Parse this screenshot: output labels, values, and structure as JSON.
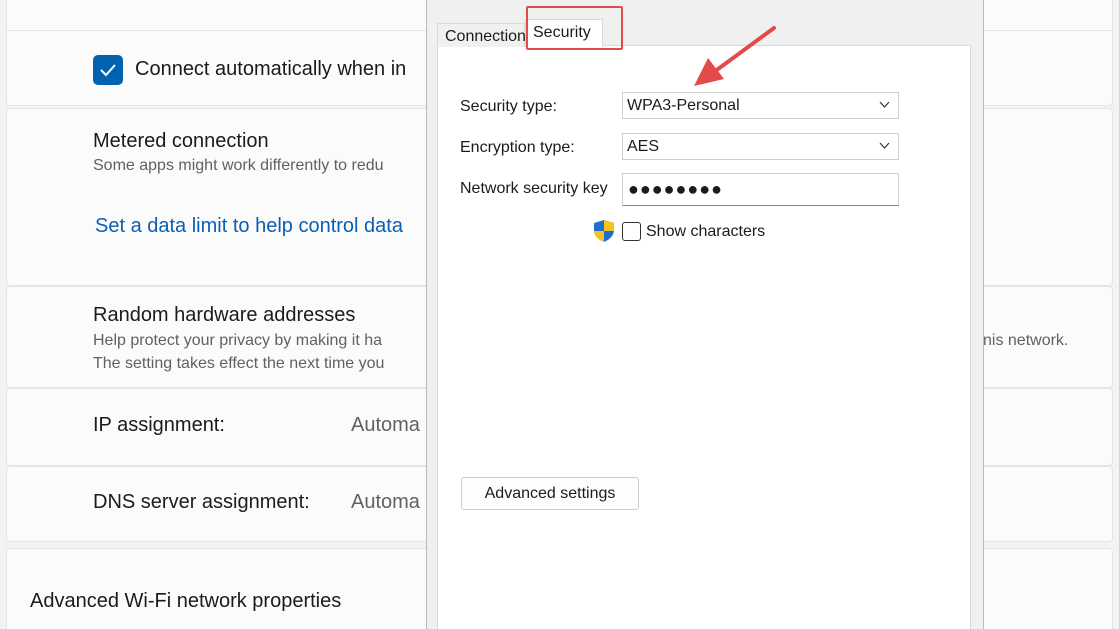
{
  "background": {
    "connect_auto_label": "Connect automatically when in",
    "metered_title": "Metered connection",
    "metered_desc": "Some apps might work differently to redu",
    "data_limit_link": "Set a data limit to help control data",
    "random_hw_title": "Random hardware addresses",
    "random_hw_desc1": "Help protect your privacy by making it ha",
    "random_hw_desc1_tail": "nis network.",
    "random_hw_desc2": "The setting takes effect the next time you",
    "ip_label": "IP assignment:",
    "ip_value": "Automa",
    "dns_label": "DNS server assignment:",
    "dns_value": "Automa",
    "advanced_wifi": "Advanced Wi-Fi network properties"
  },
  "dialog": {
    "tabs": [
      {
        "label": "Connection",
        "selected": false
      },
      {
        "label": "Security",
        "selected": true
      }
    ],
    "security_type_label": "Security type:",
    "security_type_value": "WPA3-Personal",
    "encryption_type_label": "Encryption type:",
    "encryption_type_value": "AES",
    "network_key_label": "Network security key",
    "network_key_value": "●●●●●●●●",
    "show_characters_label": "Show characters",
    "show_characters_checked": false,
    "advanced_button": "Advanced settings"
  },
  "colors": {
    "accent": "#0063b1",
    "link": "#0a5fb4",
    "annotation": "#e34a4a"
  }
}
